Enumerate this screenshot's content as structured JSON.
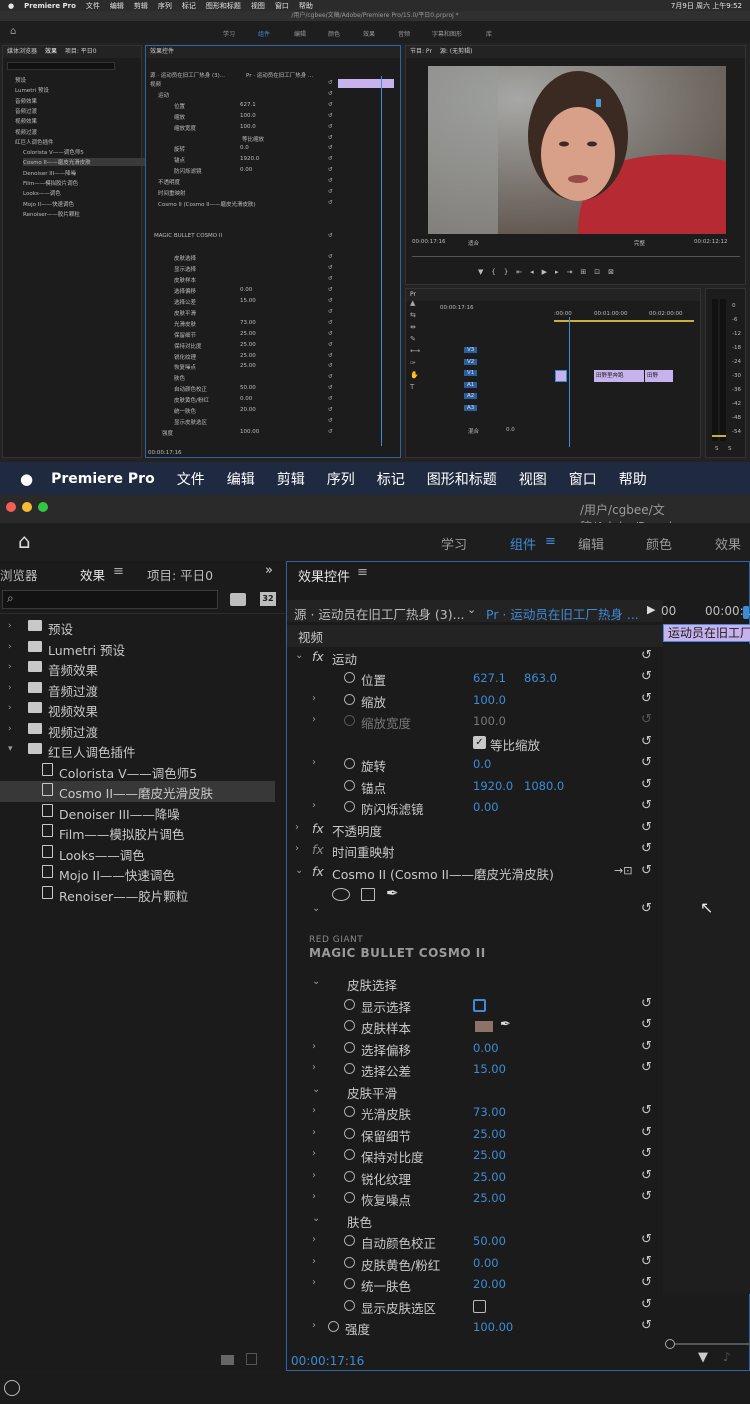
{
  "overview": {
    "menubar": [
      "Premiere Pro",
      "文件",
      "编辑",
      "剪辑",
      "序列",
      "标记",
      "图形和标题",
      "视图",
      "窗口",
      "帮助"
    ],
    "clock": "7月9日 周六 上午9:52",
    "path": "/用户/cgbee/文稿/Adobe/Premiere Pro/15.0/平日0.prproj *",
    "workspaces": [
      "学习",
      "组件",
      "编辑",
      "颜色",
      "效果",
      "音频",
      "字幕和图形",
      "库"
    ],
    "left_panel": {
      "tabs": [
        "媒体浏览器",
        "效果",
        "项目: 平日0"
      ]
    },
    "fx_panel": {
      "title": "效果控件",
      "source": "源 · 运动员在旧工厂热身 (3)...",
      "clip": "Pr · 运动员在旧工厂热身 ...",
      "timecode": "00:00:17:16"
    },
    "program": {
      "title": "节目: Pr",
      "source": "源: (无剪辑)",
      "timecode": "00:00:17:16",
      "fit": "适合",
      "quality": "完整",
      "duration": "00:02:12:12"
    },
    "timeline": {
      "title": "Pr",
      "timecode": "00:00:17:16",
      "ruler": [
        ":00:00",
        "00:01:00:00",
        "00:02:00:00"
      ],
      "tracks": [
        "V3",
        "V2",
        "V1",
        "A1",
        "A2",
        "A3"
      ],
      "mix": "混合",
      "mix_val": "0.0",
      "clips": [
        "运",
        "田野里奔跑",
        "田野"
      ]
    },
    "meter": [
      "0",
      "-6",
      "-12",
      "-18",
      "-24",
      "-30",
      "-36",
      "-42",
      "-48",
      "-54"
    ],
    "meter_foot": [
      "S",
      "S"
    ]
  },
  "menubar": {
    "apple": "",
    "app": "Premiere Pro",
    "items": [
      "文件",
      "编辑",
      "剪辑",
      "序列",
      "标记",
      "图形和标题",
      "视图",
      "窗口",
      "帮助"
    ]
  },
  "path": "/用户/cgbee/文稿/Adobe/Premi",
  "workspaces": [
    "学习",
    "组件",
    "编辑",
    "颜色",
    "效果"
  ],
  "left": {
    "tab_media": "浏览器",
    "tab_effects": "效果",
    "tab_project": "项目: 平日0",
    "tree": [
      {
        "label": "预设",
        "level": 0
      },
      {
        "label": "Lumetri 预设",
        "level": 0
      },
      {
        "label": "音频效果",
        "level": 0
      },
      {
        "label": "音频过渡",
        "level": 0
      },
      {
        "label": "视频效果",
        "level": 0
      },
      {
        "label": "视频过渡",
        "level": 0
      },
      {
        "label": "红巨人调色插件",
        "level": 0,
        "open": true
      },
      {
        "label": "Colorista V——调色师5",
        "level": 1
      },
      {
        "label": "Cosmo II——磨皮光滑皮肤",
        "level": 1,
        "selected": true
      },
      {
        "label": "Denoiser III——降噪",
        "level": 1
      },
      {
        "label": "Film——模拟胶片调色",
        "level": 1
      },
      {
        "label": "Looks——调色",
        "level": 1
      },
      {
        "label": "Mojo II——快速调色",
        "level": 1
      },
      {
        "label": "Renoiser——胶片颗粒",
        "level": 1
      }
    ]
  },
  "fx": {
    "title": "效果控件",
    "source": "源 · 运动员在旧工厂热身 (3)...",
    "clip": "Pr · 运动员在旧工厂热身 ...",
    "ruler": [
      "00",
      "00:00:1"
    ],
    "clip_label": "运动员在旧工厂",
    "section_video": "视频",
    "motion": "运动",
    "position": {
      "label": "位置",
      "x": "627.1",
      "y": "863.0"
    },
    "scale": {
      "label": "缩放",
      "value": "100.0"
    },
    "scale_width": {
      "label": "缩放宽度",
      "value": "100.0"
    },
    "uniform": "等比缩放",
    "rotation": {
      "label": "旋转",
      "value": "0.0"
    },
    "anchor": {
      "label": "锚点",
      "x": "1920.0",
      "y": "1080.0"
    },
    "antiflicker": {
      "label": "防闪烁滤镜",
      "value": "0.00"
    },
    "opacity": "不透明度",
    "timeremap": "时间重映射",
    "cosmo": "Cosmo II (Cosmo II——磨皮光滑皮肤)",
    "logo_top": "RED GIANT",
    "logo_bottom": "MAGIC BULLET COSMO II",
    "skin_select": "皮肤选择",
    "show_sel": "显示选择",
    "skin_sample": "皮肤样本",
    "sel_offset": {
      "label": "选择偏移",
      "value": "0.00"
    },
    "sel_tol": {
      "label": "选择公差",
      "value": "15.00"
    },
    "skin_smooth": "皮肤平滑",
    "smooth": {
      "label": "光滑皮肤",
      "value": "73.00"
    },
    "detail": {
      "label": "保留细节",
      "value": "25.00"
    },
    "contrast": {
      "label": "保持对比度",
      "value": "25.00"
    },
    "sharpen": {
      "label": "锐化纹理",
      "value": "25.00"
    },
    "noise": {
      "label": "恢复噪点",
      "value": "25.00"
    },
    "color": "肤色",
    "autocolor": {
      "label": "自动颜色校正",
      "value": "50.00"
    },
    "yellowpink": {
      "label": "皮肤黄色/粉红",
      "value": "0.00"
    },
    "unify": {
      "label": "统一肤色",
      "value": "20.00"
    },
    "showskin": "显示皮肤选区",
    "strength": {
      "label": "强度",
      "value": "100.00"
    },
    "timecode": "00:00:17:16"
  },
  "colors": {
    "accent": "#3f8bd6",
    "clip": "#c7b2ee",
    "sample": "#8d7268"
  }
}
